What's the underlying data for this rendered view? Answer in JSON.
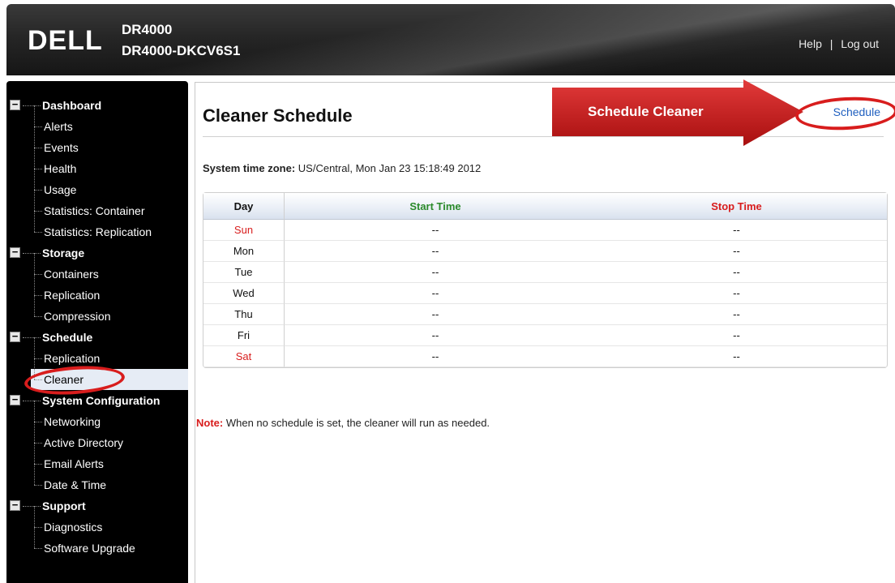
{
  "header": {
    "logo": "DELL",
    "product": "DR4000",
    "host": "DR4000-DKCV6S1",
    "help_label": "Help",
    "separator": "|",
    "logout_label": "Log out"
  },
  "sidebar": {
    "groups": [
      {
        "label": "Dashboard",
        "toggle": "−",
        "items": [
          "Alerts",
          "Events",
          "Health",
          "Usage",
          "Statistics: Container",
          "Statistics: Replication"
        ]
      },
      {
        "label": "Storage",
        "toggle": "−",
        "items": [
          "Containers",
          "Replication",
          "Compression"
        ]
      },
      {
        "label": "Schedule",
        "toggle": "−",
        "items": [
          "Replication",
          "Cleaner"
        ]
      },
      {
        "label": "System Configuration",
        "toggle": "−",
        "items": [
          "Networking",
          "Active Directory",
          "Email Alerts",
          "Date & Time"
        ]
      },
      {
        "label": "Support",
        "toggle": "−",
        "items": [
          "Diagnostics",
          "Software Upgrade"
        ]
      }
    ],
    "selected": "Cleaner"
  },
  "main": {
    "title": "Cleaner Schedule",
    "schedule_link": "Schedule",
    "annotation": "Schedule Cleaner",
    "timezone_label": "System time zone:",
    "timezone_value": "US/Central, Mon Jan 23 15:18:49 2012",
    "table": {
      "headers": {
        "day": "Day",
        "start": "Start Time",
        "stop": "Stop Time"
      },
      "rows": [
        {
          "day": "Sun",
          "start": "--",
          "stop": "--",
          "weekend": true
        },
        {
          "day": "Mon",
          "start": "--",
          "stop": "--",
          "weekend": false
        },
        {
          "day": "Tue",
          "start": "--",
          "stop": "--",
          "weekend": false
        },
        {
          "day": "Wed",
          "start": "--",
          "stop": "--",
          "weekend": false
        },
        {
          "day": "Thu",
          "start": "--",
          "stop": "--",
          "weekend": false
        },
        {
          "day": "Fri",
          "start": "--",
          "stop": "--",
          "weekend": false
        },
        {
          "day": "Sat",
          "start": "--",
          "stop": "--",
          "weekend": true
        }
      ]
    },
    "note_label": "Note:",
    "note_text": "When no schedule is set, the cleaner will run as needed."
  },
  "colors": {
    "accent_red": "#d81d1d",
    "start_green": "#2b8a2b",
    "link_blue": "#1f5fbf",
    "selected_bg": "#e6ecf5"
  }
}
